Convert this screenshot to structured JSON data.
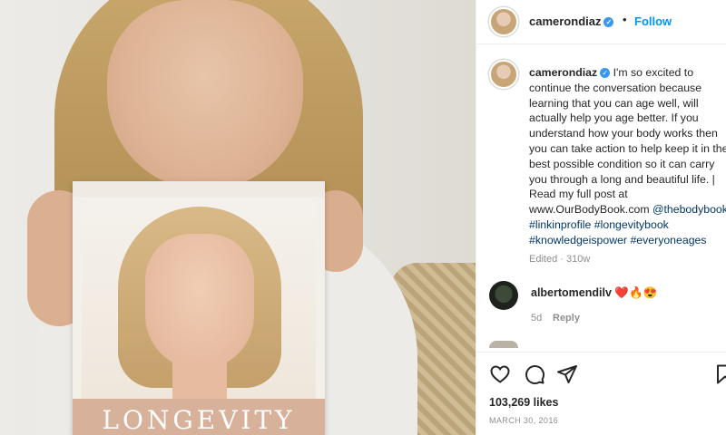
{
  "post": {
    "book_title": "LONGEVITY"
  },
  "header": {
    "username": "camerondiaz",
    "verified_glyph": "✓",
    "separator": "•",
    "follow_label": "Follow"
  },
  "caption": {
    "username": "camerondiaz",
    "lines": [
      " I'm so excited to",
      "continue the conversation because",
      "learning that you can age well, will",
      "actually help you age better. If you",
      "understand how your body works then",
      "you can take action to help keep it in the",
      "best possible condition so it can carry",
      "you through a long and beautiful life. |",
      "Read my full post at"
    ],
    "url": "www.OurBodyBook.com",
    "mention": "@thebodybook",
    "tags_line1": [
      "#linkinprofile",
      "#longevitybook"
    ],
    "tags_line2": [
      "#knowledgeispower",
      "#everyoneages"
    ],
    "meta": "Edited · 310w"
  },
  "comment": {
    "username": "albertomendilv",
    "emojis": "❤️🔥😍",
    "age": "5d",
    "reply_label": "Reply"
  },
  "actions": {
    "icons": [
      "heart-icon",
      "comment-icon",
      "share-icon",
      "bookmark-icon"
    ],
    "likes": "103,269 likes",
    "date": "MARCH 30, 2016"
  }
}
